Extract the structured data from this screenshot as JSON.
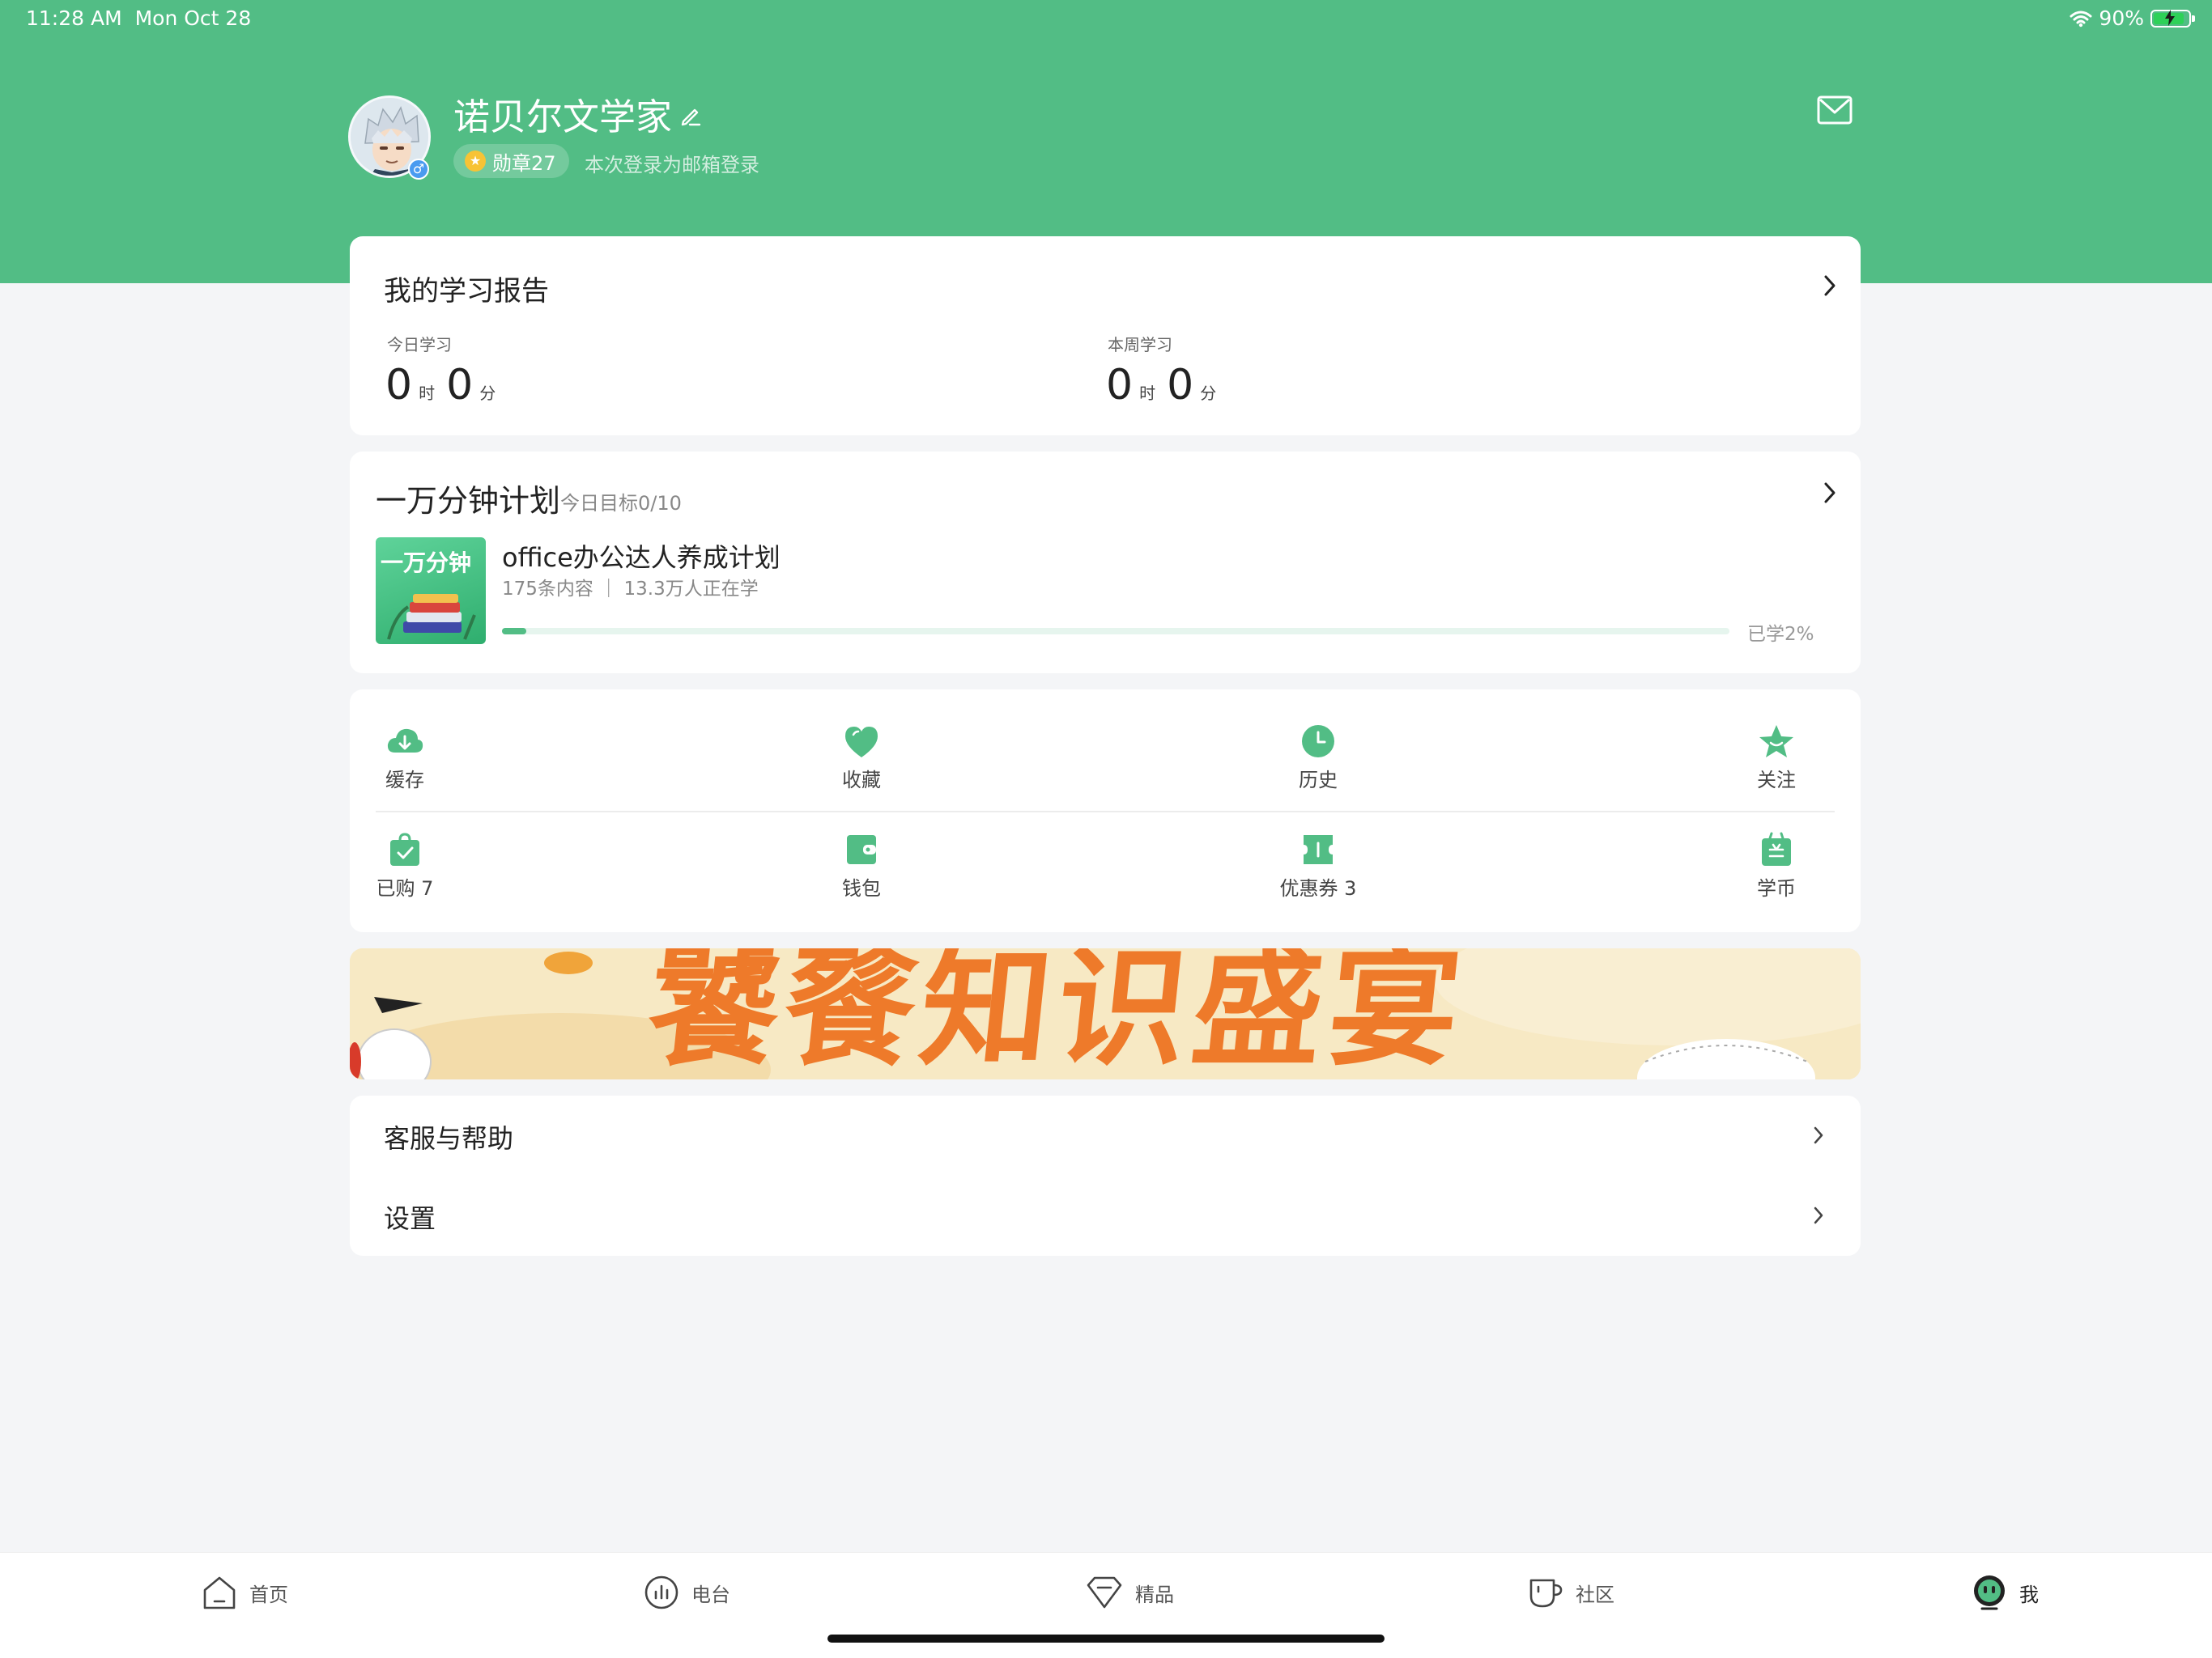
{
  "status_bar": {
    "time": "11:28 AM",
    "date": "Mon Oct 28",
    "battery": "90%",
    "battery_level": 0.9
  },
  "profile": {
    "username": "诺贝尔文学家",
    "badge_label": "勋章27",
    "login_note": "本次登录为邮箱登录",
    "gender_symbol": "♂",
    "icons": [
      "edit-icon",
      "mail-icon",
      "avatar"
    ]
  },
  "report": {
    "title": "我的学习报告",
    "today": {
      "label": "今日学习",
      "hours": "0",
      "hours_unit": "时",
      "minutes": "0",
      "minutes_unit": "分"
    },
    "week": {
      "label": "本周学习",
      "hours": "0",
      "hours_unit": "时",
      "minutes": "0",
      "minutes_unit": "分"
    }
  },
  "plan": {
    "title": "一万分钟计划",
    "daily_goal": "今日目标0/10",
    "cover_text": "一万分钟",
    "course_name": "office办公达人养成计划",
    "course_meta": "175条内容 ｜ 13.3万人正在学",
    "progress_percent": 2,
    "progress_label": "已学2%"
  },
  "shortcuts": {
    "row1": [
      {
        "label": "缓存",
        "icon": "cloud-download-icon"
      },
      {
        "label": "收藏",
        "icon": "heart-icon"
      },
      {
        "label": "历史",
        "icon": "clock-icon"
      },
      {
        "label": "关注",
        "icon": "star-icon"
      }
    ],
    "row2": [
      {
        "label": "已购 7",
        "icon": "shopping-bag-icon"
      },
      {
        "label": "钱包",
        "icon": "wallet-icon"
      },
      {
        "label": "优惠券 3",
        "icon": "coupon-icon"
      },
      {
        "label": "学币",
        "icon": "coin-icon"
      }
    ]
  },
  "banner": {
    "text": "饕餮知识盛宴"
  },
  "menu": [
    {
      "label": "客服与帮助"
    },
    {
      "label": "设置"
    }
  ],
  "tabbar": [
    {
      "label": "首页",
      "icon": "home-icon",
      "active": false
    },
    {
      "label": "电台",
      "icon": "radio-icon",
      "active": false
    },
    {
      "label": "精品",
      "icon": "diamond-icon",
      "active": false
    },
    {
      "label": "社区",
      "icon": "cup-icon",
      "active": false
    },
    {
      "label": "我",
      "icon": "me-icon",
      "active": true
    }
  ],
  "colors": {
    "brand_green": "#52bd85",
    "badge_gold": "#f7c335",
    "banner_orange": "#ee7a2a"
  }
}
